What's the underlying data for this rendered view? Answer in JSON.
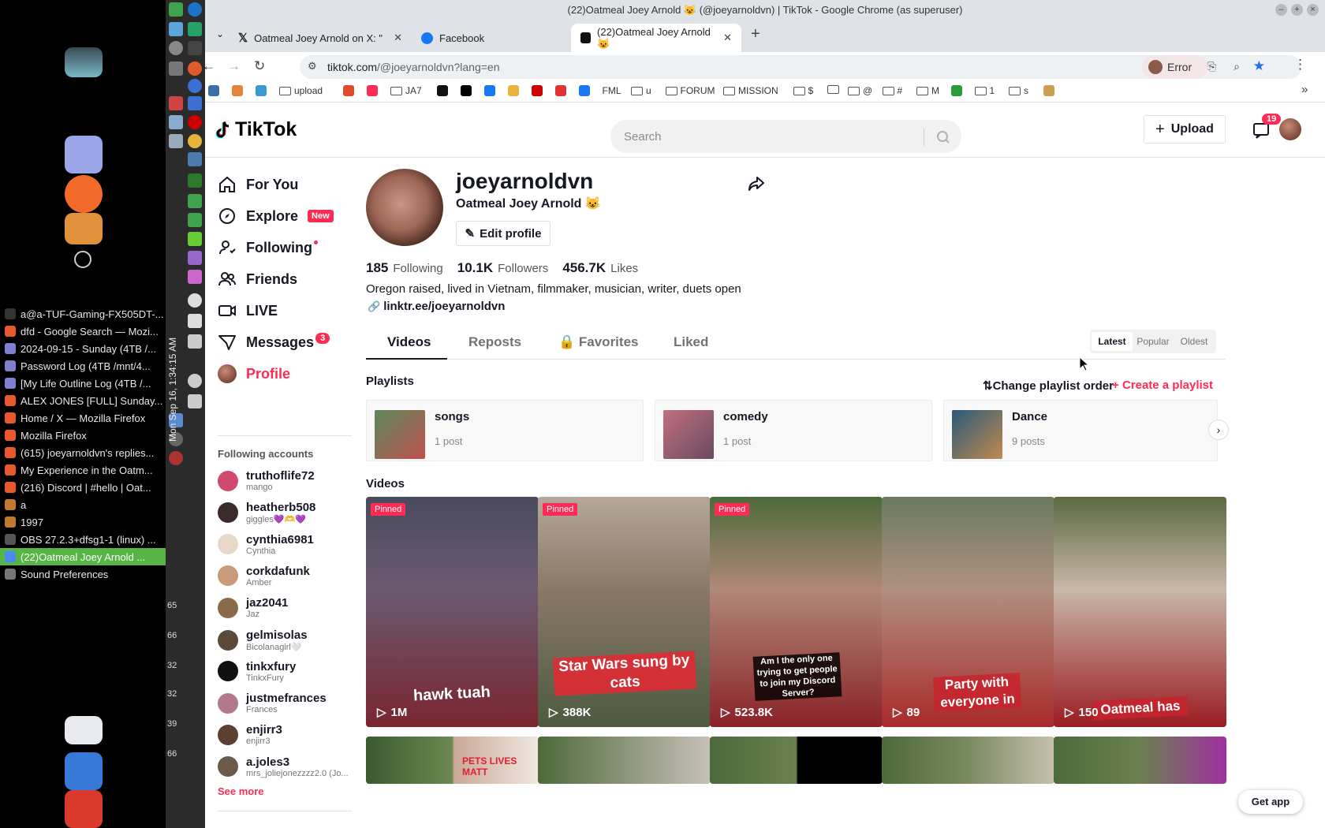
{
  "desktop": {
    "tasks": [
      {
        "label": "a@a-TUF-Gaming-FX505DT-...",
        "color": "#333"
      },
      {
        "label": "dfd - Google Search — Mozi...",
        "color": "#e8582c"
      },
      {
        "label": "2024-09-15 - Sunday (4TB /...",
        "color": "#8080d0"
      },
      {
        "label": "Password Log (4TB /mnt/4...",
        "color": "#8080d0"
      },
      {
        "label": "[My Life Outline Log (4TB /...",
        "color": "#8080d0"
      },
      {
        "label": "ALEX JONES [FULL] Sunday...",
        "color": "#e8582c"
      },
      {
        "label": "Home / X — Mozilla Firefox",
        "color": "#e8582c"
      },
      {
        "label": "Mozilla Firefox",
        "color": "#e8582c"
      },
      {
        "label": "(615) joeyarnoldvn's replies...",
        "color": "#e8582c"
      },
      {
        "label": "My Experience in the Oatm...",
        "color": "#e8582c"
      },
      {
        "label": "(216) Discord | #hello | Oat...",
        "color": "#e8582c"
      },
      {
        "label": "a",
        "color": "#c07a30"
      },
      {
        "label": "1997",
        "color": "#c07a30"
      },
      {
        "label": "OBS 27.2.3+dfsg1-1 (linux) ...",
        "color": "#555"
      },
      {
        "label": "(22)Oatmeal Joey Arnold ...",
        "color": "#4a8af4"
      },
      {
        "label": "Sound Preferences",
        "color": "#777"
      }
    ],
    "clock": "Mon Sep 16, 1:34:15 AM",
    "panel_numbers": [
      "65",
      "66",
      "32",
      "32",
      "39",
      "66"
    ]
  },
  "browser": {
    "window_title": "(22)Oatmeal Joey Arnold 😺 (@joeyarnoldvn) | TikTok - Google Chrome (as superuser)",
    "tabs": [
      {
        "label": "Oatmeal Joey Arnold on X: \""
      },
      {
        "label": "Facebook"
      },
      {
        "label": "(22)Oatmeal Joey Arnold 😺"
      }
    ],
    "url_site": "tiktok.com",
    "url_rest": "/@joeyarnoldvn?lang=en",
    "profile_button": "Error",
    "bookmarks": [
      "upload",
      "JA7",
      "FORUM",
      "MISSION",
      "$",
      "@",
      "#",
      "M",
      "1",
      "s",
      "u",
      "FML"
    ]
  },
  "tiktok": {
    "logo": "TikTok",
    "search_placeholder": "Search",
    "upload_label": "Upload",
    "inbox_count": "19",
    "nav": {
      "for_you": "For You",
      "explore": "Explore",
      "explore_badge": "New",
      "following": "Following",
      "friends": "Friends",
      "live": "LIVE",
      "messages": "Messages",
      "messages_badge": "3",
      "profile": "Profile"
    },
    "following_accounts_title": "Following accounts",
    "following_accounts": [
      {
        "user": "truthoflife72",
        "name": "mango"
      },
      {
        "user": "heatherb508",
        "name": "giggles💜🫶💜"
      },
      {
        "user": "cynthia6981",
        "name": "Cynthia"
      },
      {
        "user": "corkdafunk",
        "name": "Amber"
      },
      {
        "user": "jaz2041",
        "name": "Jaz"
      },
      {
        "user": "gelmisolas",
        "name": "Bicolanagirl🤍"
      },
      {
        "user": "tinkxfury",
        "name": "TinkxFury"
      },
      {
        "user": "justmefrances",
        "name": "Frances"
      },
      {
        "user": "enjirr3",
        "name": "enjirr3"
      },
      {
        "user": "a.joles3",
        "name": "mrs_joliejonezzzz2.0 (Jo..."
      }
    ],
    "see_more": "See more",
    "profile": {
      "username": "joeyarnoldvn",
      "nickname": "Oatmeal Joey Arnold 😺",
      "edit_profile": "Edit profile",
      "following_count": "185",
      "following_label": "Following",
      "followers_count": "10.1K",
      "followers_label": "Followers",
      "likes_count": "456.7K",
      "likes_label": "Likes",
      "bio": "Oregon raised, lived in Vietnam, filmmaker, musician, writer, duets open",
      "link": "linktr.ee/joeyarnoldvn"
    },
    "profile_tabs": {
      "videos": "Videos",
      "reposts": "Reposts",
      "favorites": "Favorites",
      "liked": "Liked"
    },
    "sort": {
      "latest": "Latest",
      "popular": "Popular",
      "oldest": "Oldest"
    },
    "playlists_title": "Playlists",
    "change_order": "Change playlist order",
    "create_playlist": "Create a playlist",
    "playlists": [
      {
        "title": "songs",
        "count": "1 post"
      },
      {
        "title": "comedy",
        "count": "1 post"
      },
      {
        "title": "Dance",
        "count": "9 posts"
      }
    ],
    "videos_title": "Videos",
    "videos": [
      {
        "pinned": "Pinned",
        "views": "1M",
        "caption": "hawk tuah"
      },
      {
        "pinned": "Pinned",
        "views": "388K",
        "caption": "Star Wars sung by cats"
      },
      {
        "pinned": "Pinned",
        "views": "523.8K",
        "caption": "Am I the only one trying to get people to join my Discord Server?"
      },
      {
        "pinned": "",
        "views": "89",
        "caption": "Party with everyone in"
      },
      {
        "pinned": "",
        "views": "150",
        "caption": "Oatmeal has"
      }
    ],
    "row2_caption": "PETS LIVES MATT",
    "get_app": "Get app"
  }
}
